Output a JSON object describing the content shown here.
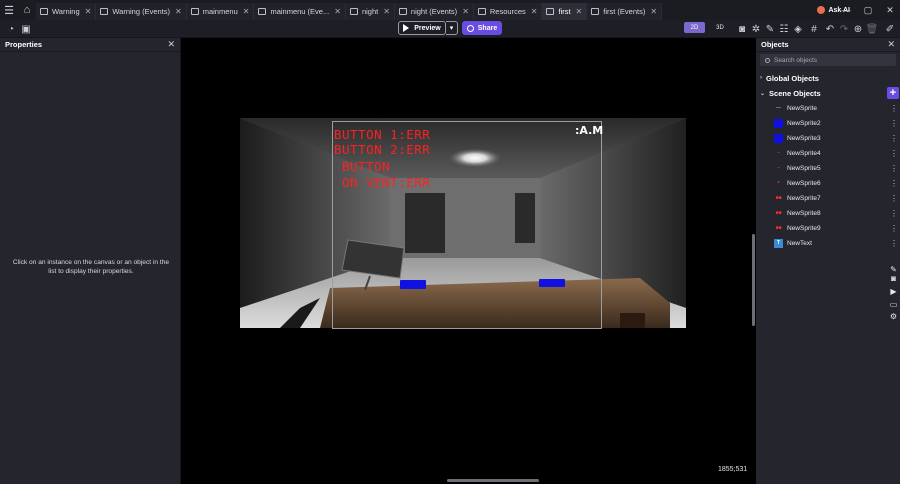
{
  "tabs": [
    {
      "label": "Warning",
      "active": false
    },
    {
      "label": "Warning (Events)",
      "active": false
    },
    {
      "label": "mainmenu",
      "active": false
    },
    {
      "label": "mainmenu (Eve...",
      "active": false
    },
    {
      "label": "night",
      "active": false
    },
    {
      "label": "night (Events)",
      "active": false
    },
    {
      "label": "Resources",
      "active": false
    },
    {
      "label": "first",
      "active": true
    },
    {
      "label": "first (Events)",
      "active": false
    }
  ],
  "header": {
    "ask_ai_label": "Ask AI"
  },
  "toolbar": {
    "preview_label": "Preview",
    "share_label": "Share",
    "mode_2d": "2D",
    "mode_3d": "3D"
  },
  "properties": {
    "title": "Properties",
    "hint": "Click on an instance on the canvas or an object in the list to display their properties."
  },
  "canvas": {
    "overlay_lines": [
      "BUTTON 1:ERR",
      "BUTTON 2:ERR",
      " BUTTON",
      " ON VENT:ERR"
    ],
    "am_label": ":A.M",
    "coords": "1855;531"
  },
  "objects_panel": {
    "title": "Objects",
    "search_placeholder": "Search objects",
    "global_group": "Global Objects",
    "scene_group": "Scene Objects",
    "items": [
      {
        "name": "NewSprite",
        "thumb": "~"
      },
      {
        "name": "NewSprite2",
        "thumb": "blue"
      },
      {
        "name": "NewSprite3",
        "thumb": "blue"
      },
      {
        "name": "NewSprite4",
        "thumb": "~"
      },
      {
        "name": "NewSprite5",
        "thumb": "~"
      },
      {
        "name": "NewSprite6",
        "thumb": "~"
      },
      {
        "name": "NewSprite7",
        "thumb": "text"
      },
      {
        "name": "NewSprite8",
        "thumb": "text"
      },
      {
        "name": "NewSprite9",
        "thumb": "text"
      },
      {
        "name": "NewText",
        "thumb": "T"
      }
    ]
  },
  "colors": {
    "accent": "#6b4ce2",
    "mode_active": "#7b69d0",
    "overlay_text": "#ff2020",
    "sprite_blue": "#1010e0"
  }
}
